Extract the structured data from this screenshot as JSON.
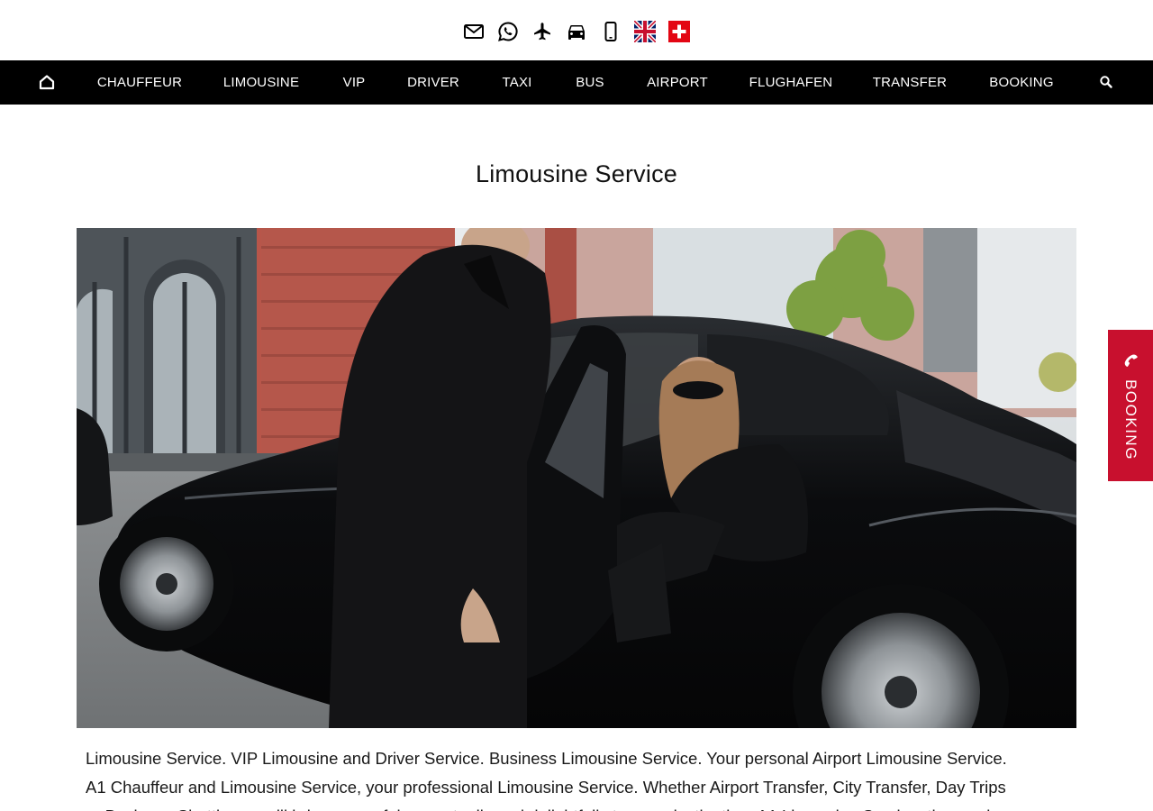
{
  "topbar": {
    "icons": [
      "mail-icon",
      "whatsapp-icon",
      "airplane-icon",
      "car-icon",
      "mobile-phone-icon",
      "uk-flag-icon",
      "swiss-flag-icon"
    ]
  },
  "nav": {
    "items": [
      {
        "label": "CHAUFFEUR"
      },
      {
        "label": "LIMOUSINE"
      },
      {
        "label": "VIP"
      },
      {
        "label": "DRIVER"
      },
      {
        "label": "TAXI"
      },
      {
        "label": "BUS"
      },
      {
        "label": "AIRPORT"
      },
      {
        "label": "FLUGHAFEN"
      },
      {
        "label": "TRANSFER"
      },
      {
        "label": "BOOKING"
      }
    ],
    "home_icon": "home-icon",
    "search_icon": "search-icon"
  },
  "page": {
    "title": "Limousine Service",
    "hero_alt": "Chauffeur opening the rear door of a black limousine for a smiling woman in sunglasses",
    "intro_lines": [
      "Limousine Service. VIP Limousine and Driver Service. Business Limousine Service. Your personal Airport Limousine Service.",
      "A1 Chauffeur and Limousine Service, your professional Limousine Service. Whether Airport Transfer, City Transfer, Day Trips",
      "or Business Shuttle, we will bring you safely, punctually and delightfully to your destination. A1 Limousine Service, the service"
    ]
  },
  "booking_tab": {
    "label": "BOOKING",
    "icon": "phone-icon"
  },
  "colors": {
    "nav_bg": "#000000",
    "nav_text": "#ffffff",
    "booking_red": "#c8102e"
  }
}
